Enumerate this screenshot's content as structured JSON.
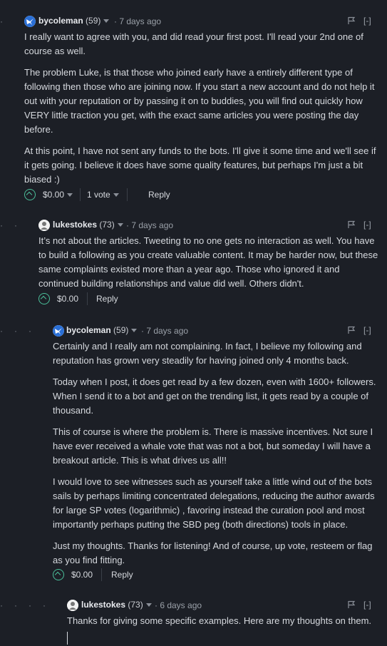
{
  "comments": [
    {
      "author": "bycoleman",
      "rep": "(59)",
      "time": "· 7 days ago",
      "collapse": "[-]",
      "paragraphs": [
        "I really want to agree with you, and did read your first post. I'll read your 2nd one of course as well.",
        "The problem Luke, is that those who joined early have a entirely different type of following then those who are joining now. If you start a new account and do not help it out with your reputation or by passing it on to buddies, you will find out quickly how VERY little traction you get, with the exact same articles you were posting the day before.",
        "At this point, I have not sent any funds to the bots. I'll give it some time and we'll see if it gets going. I believe it does have some quality features, but perhaps I'm just a bit biased :)"
      ],
      "payout": "$0.00",
      "votes": "1 vote",
      "reply": "Reply"
    },
    {
      "author": "lukestokes",
      "rep": "(73)",
      "time": "· 7 days ago",
      "collapse": "[-]",
      "paragraphs": [
        "It’s not about the articles. Tweeting to no one gets no interaction as well. You have to build a following as you create valuable content. It may be harder now, but these same complaints existed more than a year ago. Those who ignored it and continued building relationships and value did well. Others didn't."
      ],
      "payout": "$0.00",
      "reply": "Reply"
    },
    {
      "author": "bycoleman",
      "rep": "(59)",
      "time": "· 7 days ago",
      "collapse": "[-]",
      "paragraphs": [
        "Certainly and I really am not complaining. In fact, I believe my following and reputation has grown very steadily for having joined only 4 months back.",
        "Today when I post, it does get read by a few dozen, even with 1600+ followers. When I send it to a bot and get on the trending list, it gets read by a couple of thousand.",
        "This of course is where the problem is. There is massive incentives. Not sure I have ever received a whale vote that was not a bot, but someday I will have a breakout article. This is what drives us all!!",
        "I would love to see witnesses such as yourself take a little wind out of the bots sails by perhaps limiting concentrated delegations, reducing the author awards for large SP votes (logarithmic) , favoring instead the curation pool and most importantly perhaps putting the SBD peg (both directions) tools in place.",
        "Just my thoughts. Thanks for listening! And of course, up vote, resteem or flag as you find fitting."
      ],
      "payout": "$0.00",
      "reply": "Reply"
    },
    {
      "author": "lukestokes",
      "rep": "(73)",
      "time": "· 6 days ago",
      "collapse": "[-]",
      "paragraphs": [
        "Thanks for giving some specific examples. Here are my thoughts on them."
      ]
    }
  ],
  "colors": {
    "background": "#1c1f26",
    "upvote": "#4bbf9a",
    "text": "#d6d9de"
  },
  "icons": {
    "flag": "flag-icon",
    "upvote": "upvote-icon",
    "caret": "chevron-down-icon"
  }
}
